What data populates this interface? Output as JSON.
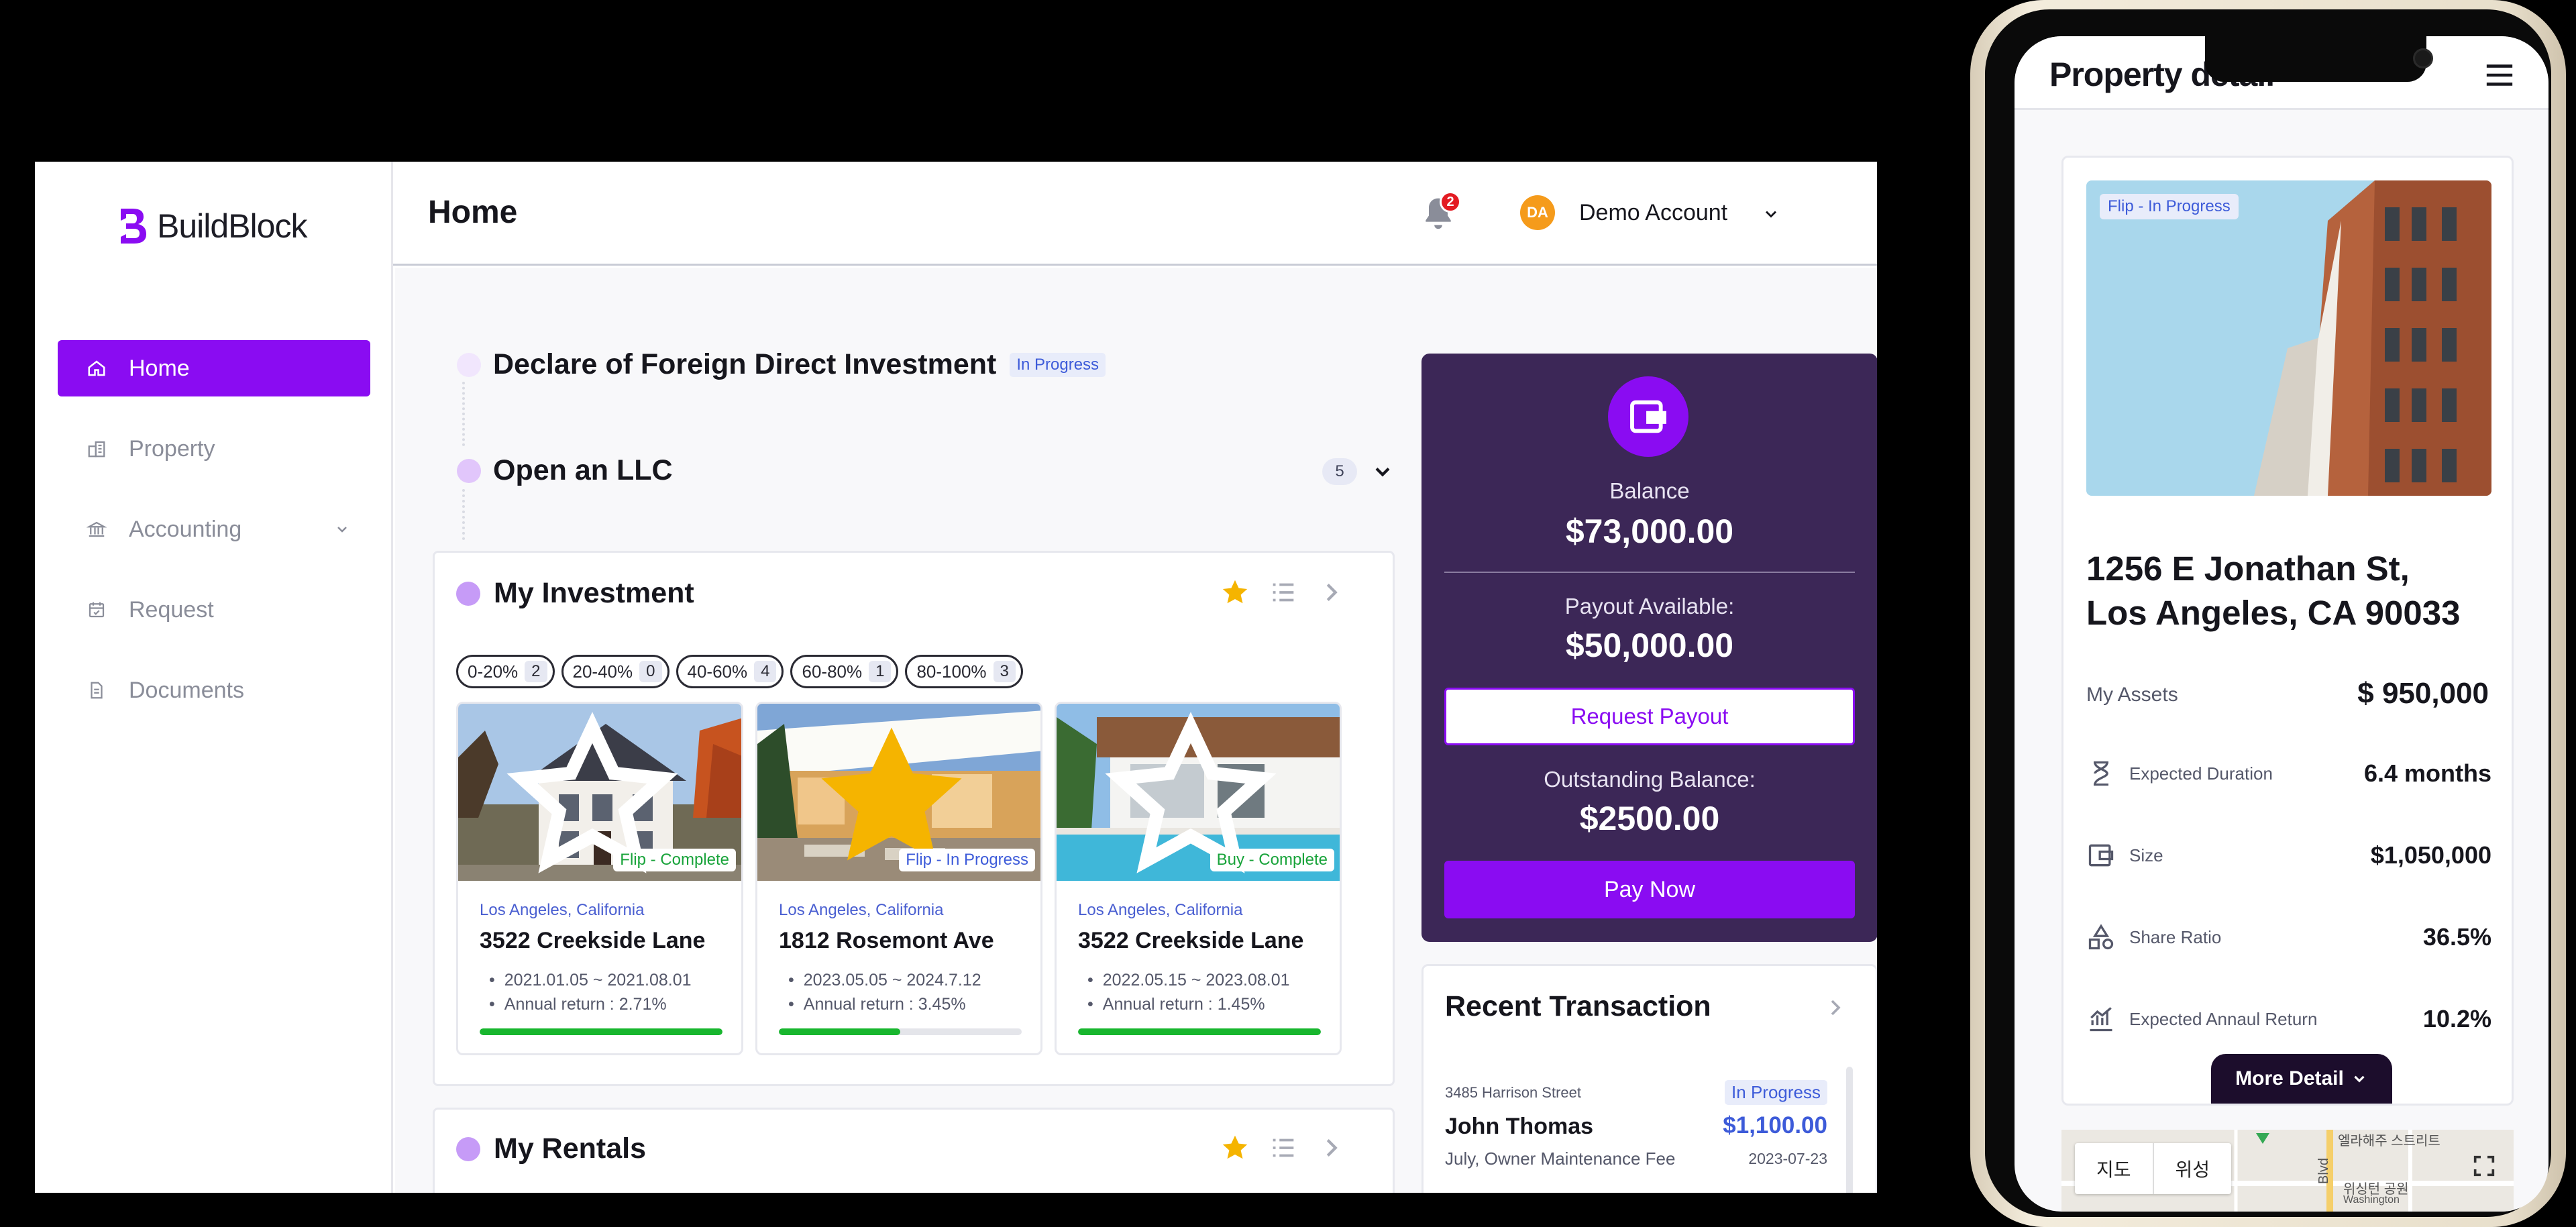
{
  "app": {
    "name": "BuildBlock",
    "brand_color": "#8a0cf2"
  },
  "sidebar": {
    "items": [
      {
        "label": "Home",
        "icon": "home-icon",
        "active": true
      },
      {
        "label": "Property",
        "icon": "property-icon"
      },
      {
        "label": "Accounting",
        "icon": "bank-icon",
        "has_submenu": true
      },
      {
        "label": "Request",
        "icon": "calendar-icon"
      },
      {
        "label": "Documents",
        "icon": "document-icon"
      }
    ]
  },
  "header": {
    "title": "Home",
    "notifications": "2",
    "account": {
      "initials": "DA",
      "name": "Demo Account"
    }
  },
  "steps": [
    {
      "title": "Declare of Foreign Direct Investment",
      "status": "In Progress"
    },
    {
      "title": "Open an LLC",
      "count": "5"
    }
  ],
  "investment": {
    "title": "My Investment",
    "filters": [
      {
        "label": "0-20%",
        "count": "2"
      },
      {
        "label": "20-40%",
        "count": "0"
      },
      {
        "label": "40-60%",
        "count": "4"
      },
      {
        "label": "60-80%",
        "count": "1"
      },
      {
        "label": "80-100%",
        "count": "3"
      }
    ],
    "cards": [
      {
        "tag": "Flip - Complete",
        "location": "Los Angeles, California",
        "name": "3522 Creekside Lane",
        "period": "2021.01.05 ~ 2021.08.01",
        "return": "Annual return :  2.71%",
        "progress": 1.0,
        "starred": false
      },
      {
        "tag": "Flip - In Progress",
        "location": "Los Angeles, California",
        "name": "1812 Rosemont Ave",
        "period": "2023.05.05 ~ 2024.7.12",
        "return": "Annual return :  3.45%",
        "progress": 0.5,
        "starred": true
      },
      {
        "tag": "Buy - Complete",
        "location": "Los Angeles, California",
        "name": "3522 Creekside Lane",
        "period": "2022.05.15 ~ 2023.08.01",
        "return": "Annual return :  1.45%",
        "progress": 1.0,
        "starred": false
      }
    ]
  },
  "rentals": {
    "title": "My Rentals"
  },
  "balance": {
    "balance_label": "Balance",
    "balance_value": "$73,000.00",
    "payout_label": "Payout Available:",
    "payout_value": "$50,000.00",
    "request_payout": "Request Payout",
    "outstanding_label": "Outstanding Balance:",
    "outstanding_value": "$2500.00",
    "pay_now": "Pay Now"
  },
  "transactions": {
    "title": "Recent Transaction",
    "items": [
      {
        "address": "3485 Harrison Street",
        "status": "In Progress",
        "name": "John Thomas",
        "amount": "$1,100.00",
        "description": "July, Owner Maintenance Fee",
        "date": "2023-07-23"
      }
    ]
  },
  "phone": {
    "title": "Property detail",
    "tag": "Flip - In Progress",
    "address_line1": "1256 E Jonathan St,",
    "address_line2": "Los Angeles, CA 90033",
    "assets_label": "My Assets",
    "assets_value": "$ 950,000",
    "stats": [
      {
        "icon": "hourglass-icon",
        "label": "Expected Duration",
        "value": "6.4 months"
      },
      {
        "icon": "wallet-icon",
        "label": "Size",
        "value": "$1,050,000"
      },
      {
        "icon": "shapes-icon",
        "label": "Share Ratio",
        "value": "36.5%"
      },
      {
        "icon": "growth-chart-icon",
        "label": "Expected Annaul Return",
        "value": "10.2%"
      }
    ],
    "more_detail": "More Detail",
    "map": {
      "map_tab": "지도",
      "satellite_tab": "위성",
      "label1": "엘라해주 스트리트",
      "label2": "위싱턴 공원",
      "label3": "Washington",
      "label4": "Blvd"
    }
  }
}
